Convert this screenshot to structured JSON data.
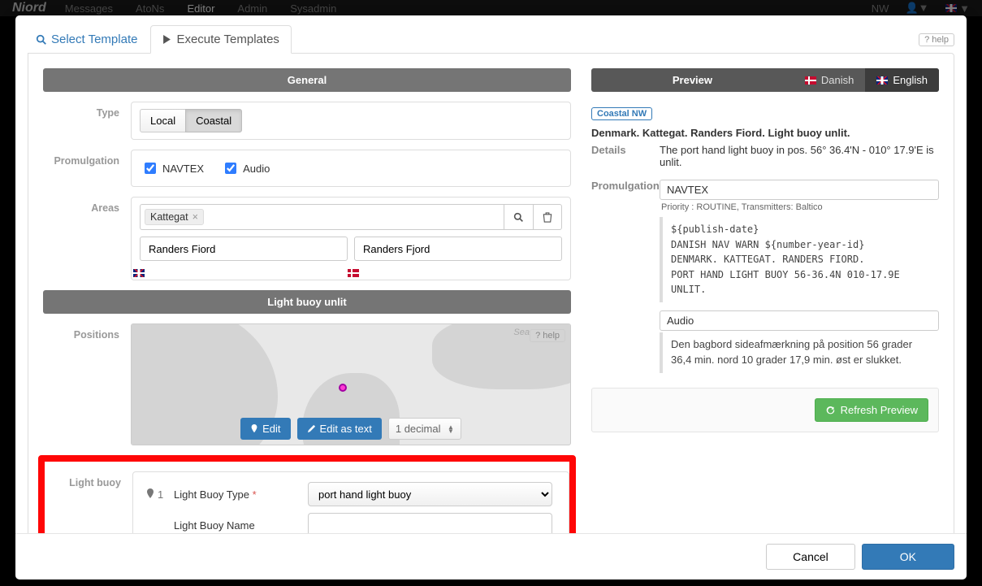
{
  "topbar": {
    "brand": "Niord",
    "menu": [
      "Messages",
      "AtoNs",
      "Editor",
      "Admin",
      "Sysadmin"
    ],
    "active_menu": "Editor",
    "user": "NW"
  },
  "modal": {
    "select_template": "Select Template",
    "tab_execute": "Execute Templates",
    "help": "help"
  },
  "general": {
    "header": "General",
    "type_label": "Type",
    "type_options": [
      "Local",
      "Coastal"
    ],
    "type_selected": "Coastal",
    "promulgation_label": "Promulgation",
    "navtex_label": "NAVTEX",
    "navtex_checked": true,
    "audio_label": "Audio",
    "audio_checked": true,
    "areas_label": "Areas",
    "area_tag": "Kattegat",
    "area_en": "Randers Fiord",
    "area_dk": "Randers Fjord"
  },
  "section2": {
    "header": "Light buoy unlit",
    "positions_label": "Positions",
    "sea_label": "Sea",
    "map_help": "help",
    "edit_btn": "Edit",
    "edit_text_btn": "Edit as text",
    "decimals": "1 decimal"
  },
  "lightbuoy": {
    "label": "Light buoy",
    "marker": "1",
    "type_label": "Light Buoy Type",
    "type_value": "port hand light buoy",
    "name_label": "Light Buoy Name",
    "name_value": ""
  },
  "preview": {
    "tab_preview": "Preview",
    "tab_danish": "Danish",
    "tab_english": "English",
    "badge": "Coastal NW",
    "title": "Denmark. Kattegat. Randers Fiord. Light buoy unlit.",
    "details_label": "Details",
    "details_text": "The port hand light buoy in pos. 56° 36.4'N - 010° 17.9'E is unlit.",
    "promulgation_label": "Promulgation",
    "navtex": "NAVTEX",
    "priority_line": "Priority : ROUTINE,   Transmitters: Baltico",
    "navtex_code": "${publish-date}\nDANISH NAV WARN ${number-year-id}\nDENMARK. KATTEGAT. RANDERS FIORD.\nPORT HAND LIGHT BUOY 56-36.4N 010-17.9E\nUNLIT.",
    "audio": "Audio",
    "audio_text": "Den bagbord sideafmærkning på position 56 grader 36,4 min. nord 10 grader 17,9 min. øst er slukket.",
    "refresh": "Refresh Preview"
  },
  "footer": {
    "cancel": "Cancel",
    "ok": "OK"
  }
}
